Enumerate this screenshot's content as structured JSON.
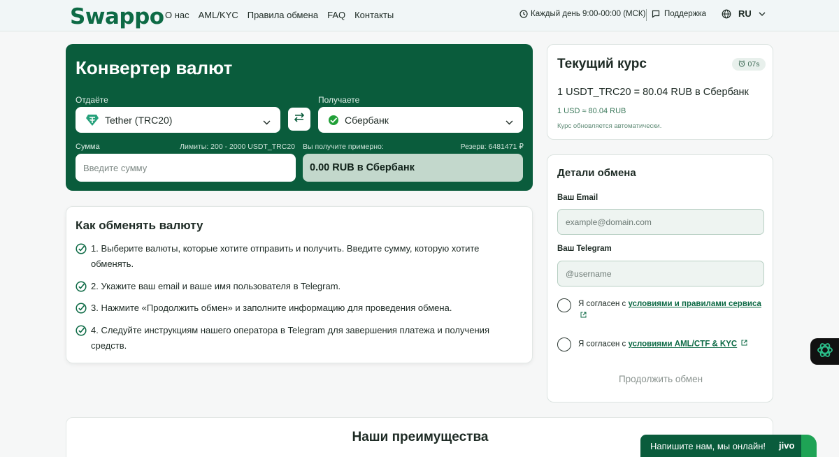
{
  "header": {
    "logo": "Swappo",
    "nav": [
      "О нас",
      "AML/KYC",
      "Правила обмена",
      "FAQ",
      "Контакты"
    ],
    "hours": "Каждый день 9:00-00:00 (МСК)",
    "support": "Поддержка",
    "language": "RU"
  },
  "converter": {
    "title": "Конвертер валют",
    "give_label": "Отдаёте",
    "get_label": "Получаете",
    "give_currency": "Tether (TRC20)",
    "get_currency": "Сбербанк",
    "sum_label": "Сумма",
    "limits": "Лимиты: 200 - 2000 USDT_TRC20",
    "approx_label": "Вы получите примерно:",
    "reserve": "Резерв: 6481471 ₽",
    "amount_placeholder": "Введите сумму",
    "result": "0.00 RUB в Сбербанк"
  },
  "howto": {
    "title": "Как обменять валюту",
    "steps": [
      "1. Выберите валюты, которые хотите отправить и получить. Введите сумму, которую хотите обменять.",
      "2. Укажите ваш email и ваше имя пользователя в Telegram.",
      "3. Нажмите «Продолжить обмен» и заполните информацию для проведения обмена.",
      "4. Следуйте инструкциям нашего оператора в Telegram для завершения платежа и получения средств."
    ]
  },
  "rate": {
    "title": "Текущий курс",
    "timer": "07s",
    "main": "1 USDT_TRC20 = 80.04 RUB в Сбербанк",
    "usd": "1 USD ≈ 80.04 RUB",
    "auto_note": "Курс обновляется автоматически."
  },
  "details": {
    "title": "Детали обмена",
    "email_label": "Ваш Email",
    "email_placeholder": "example@domain.com",
    "telegram_label": "Ваш Telegram",
    "telegram_placeholder": "@username",
    "agree_prefix": "Я согласен с ",
    "agree_terms_link": "условиями и правилами сервиса",
    "agree_aml_link": "условиями AML/CTF & KYC",
    "continue_button": "Продолжить обмен"
  },
  "advantages": {
    "title": "Наши преимущества"
  },
  "chat": {
    "text": "Напишите нам, мы онлайн!",
    "brand": "jivo"
  },
  "colors": {
    "brand_green": "#0a5c3c",
    "accent_green": "#0d6a45",
    "result_bg": "#c3d8cc"
  }
}
